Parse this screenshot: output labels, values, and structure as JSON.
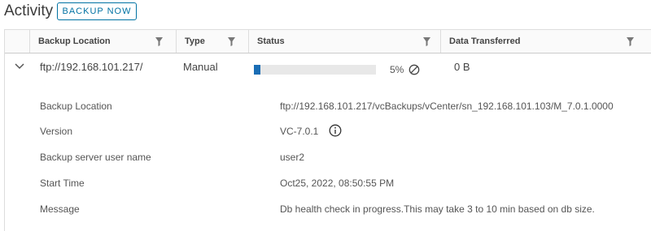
{
  "header": {
    "title": "Activity",
    "backup_now_label": "BACKUP NOW"
  },
  "table": {
    "columns": [
      "Backup Location",
      "Type",
      "Status",
      "Data Transferred"
    ],
    "row": {
      "location": "ftp://192.168.101.217/",
      "type": "Manual",
      "progress_percent": 5,
      "progress_label": "5%",
      "data_transferred": "0 B"
    },
    "details": [
      {
        "label": "Backup Location",
        "value": "ftp://192.168.101.217/vcBackups/vCenter/sn_192.168.101.103/M_7.0.1.0000"
      },
      {
        "label": "Version",
        "value": "VC-7.0.1"
      },
      {
        "label": "Backup server user name",
        "value": "user2"
      },
      {
        "label": "Start Time",
        "value": "Oct25, 2022, 08:50:55 PM"
      },
      {
        "label": "Message",
        "value": "Db health check in progress.This may take 3 to 10 min based on db size."
      }
    ]
  },
  "colors": {
    "accent": "#0072a3",
    "progress": "#1a6db5"
  }
}
